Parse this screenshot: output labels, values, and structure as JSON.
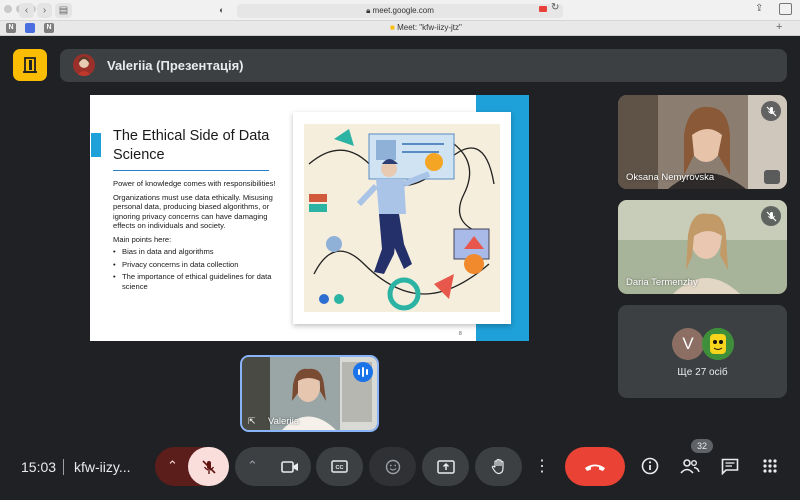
{
  "browser": {
    "address": "meet.google.com",
    "tab_title": "Meet: \"kfw-iizy-jtz\"",
    "favicons": [
      "N",
      "N"
    ]
  },
  "presenter": {
    "name": "Valeriia (Презентація)"
  },
  "slide": {
    "title": "The Ethical Side of Data Science",
    "intro": "Power of knowledge comes with responsibilities!",
    "paragraph": "Organizations must use data ethically. Misusing personal data, producing biased algorithms, or ignoring privacy concerns can have damaging effects on individuals and society.",
    "points_heading": "Main points here:",
    "points": [
      "Bias in data and algorithms",
      "Privacy concerns in data collection",
      "The importance of ethical guidelines for data science"
    ],
    "page_marker": "8"
  },
  "participants": [
    {
      "name": "Oksana Nemyrovska",
      "muted": true
    },
    {
      "name": "Daria Termenzhy",
      "muted": true
    }
  ],
  "self_view": {
    "name": "Valeriia"
  },
  "more_participants": {
    "avatar_letter": "V",
    "label": "Ще 27 осіб"
  },
  "bottom_bar": {
    "time": "15:03",
    "meeting_code": "kfw-iizy...",
    "people_count": "32"
  },
  "colors": {
    "background": "#202124",
    "tile": "#3c4043",
    "end_call": "#ea4335",
    "muted_mic_bg": "#f9dedc",
    "slide_accent": "#1ea0d8",
    "meet_logo": "#fbbc04"
  }
}
